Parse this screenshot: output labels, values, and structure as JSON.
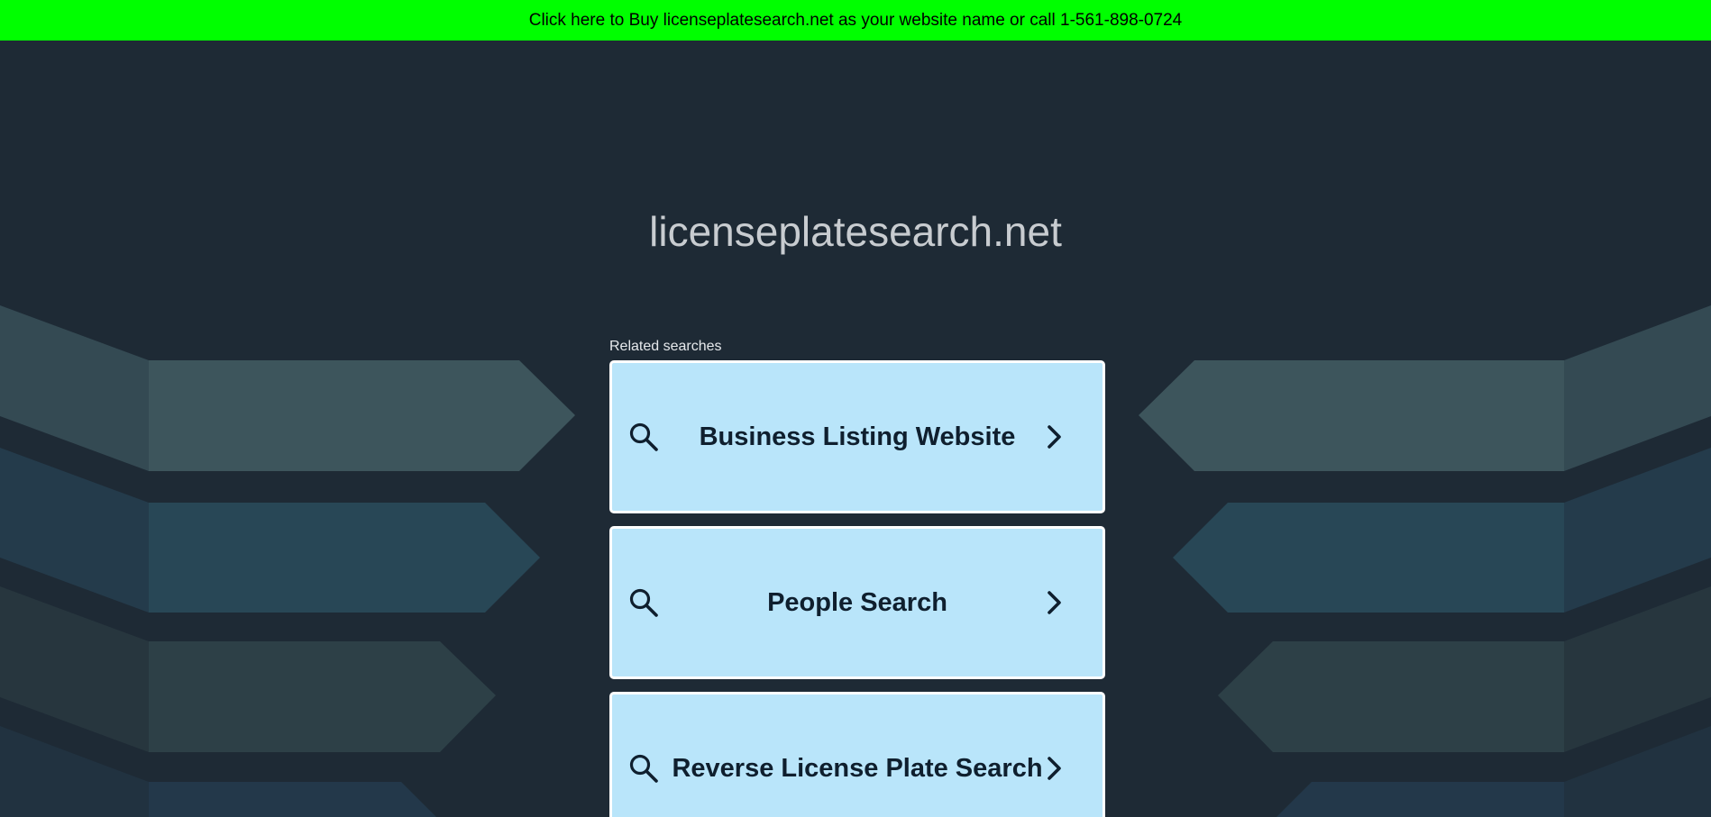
{
  "banner": {
    "text": "Click here to Buy licenseplatesearch.net as your website name or call 1-561-898-0724"
  },
  "site": {
    "domain": "licenseplatesearch.net"
  },
  "related": {
    "label": "Related searches",
    "items": [
      {
        "label": "Business Listing Website",
        "icon": "search-icon",
        "arrow": "chevron-right-icon"
      },
      {
        "label": "People Search",
        "icon": "search-icon",
        "arrow": "chevron-right-icon"
      },
      {
        "label": "Reverse License Plate Search",
        "icon": "search-icon",
        "arrow": "chevron-right-icon"
      }
    ]
  },
  "colors": {
    "banner_bg": "#00ff00",
    "page_bg": "#1e2a35",
    "card_bg": "#b9e5fa",
    "card_text": "#0f1f2e"
  }
}
